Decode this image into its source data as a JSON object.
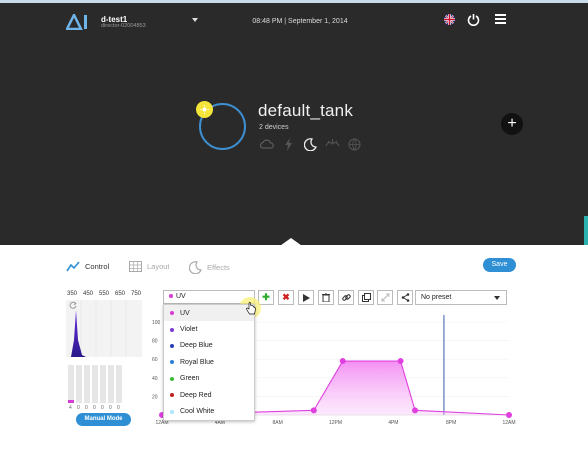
{
  "header": {
    "account_name": "d-test1",
    "account_id": "director-02004853",
    "datetime": "08:48 PM |  September 1, 2014"
  },
  "tank": {
    "name": "default_tank",
    "devices": "2 devices",
    "add_symbol": "+"
  },
  "tabs": [
    {
      "label": "Control",
      "active": true
    },
    {
      "label": "Layout",
      "active": false
    },
    {
      "label": "Effects",
      "active": false
    }
  ],
  "save_label": "Save",
  "spectrum": {
    "wavelengths": [
      "350",
      "450",
      "550",
      "650",
      "750"
    ],
    "slider_values": [
      "4",
      "0",
      "0",
      "0",
      "0",
      "0",
      "0"
    ]
  },
  "manual_mode_label": "Manual Mode",
  "channel_select": {
    "value": "UV"
  },
  "channel_options": [
    {
      "label": "UV",
      "color": "#d63bd6",
      "selected": true
    },
    {
      "label": "Violet",
      "color": "#7a3bd6"
    },
    {
      "label": "Deep Blue",
      "color": "#2a3fb8"
    },
    {
      "label": "Royal Blue",
      "color": "#2a7fd6"
    },
    {
      "label": "Green",
      "color": "#3bbf3b"
    },
    {
      "label": "Deep Red",
      "color": "#c02020"
    },
    {
      "label": "Cool White",
      "color": "#a8e6ff"
    }
  ],
  "toolbar": [
    "add-point",
    "delete-point",
    "play",
    "trash",
    "link",
    "copy",
    "expand",
    "share"
  ],
  "preset_select": {
    "value": "No preset"
  },
  "chart_data": {
    "type": "area",
    "title": "",
    "xlabel": "",
    "ylabel": "",
    "x_ticks": [
      "12AM",
      "4AM",
      "8AM",
      "12PM",
      "4PM",
      "8PM",
      "12AM"
    ],
    "y_ticks": [
      "100",
      "80",
      "60",
      "40",
      "20"
    ],
    "ylim": [
      0,
      100
    ],
    "series": [
      {
        "color": "#e040e0",
        "points": [
          [
            0,
            0
          ],
          [
            10.5,
            5
          ],
          [
            12.5,
            58
          ],
          [
            16.5,
            58
          ],
          [
            17.5,
            5
          ],
          [
            24,
            0
          ]
        ]
      }
    ],
    "current_time": 19.5
  }
}
